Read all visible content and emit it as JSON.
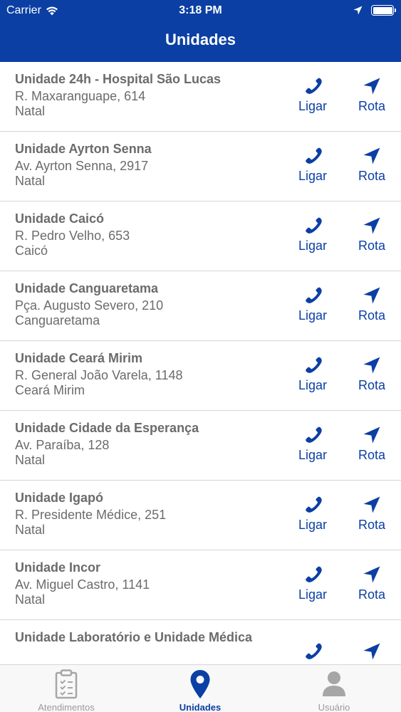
{
  "status_bar": {
    "carrier": "Carrier",
    "time": "3:18 PM"
  },
  "nav": {
    "title": "Unidades"
  },
  "actions": {
    "call_label": "Ligar",
    "route_label": "Rota"
  },
  "units": [
    {
      "name": "Unidade 24h - Hospital São Lucas",
      "address": "R. Maxaranguape, 614",
      "city": "Natal"
    },
    {
      "name": "Unidade Ayrton Senna",
      "address": "Av. Ayrton Senna, 2917",
      "city": "Natal"
    },
    {
      "name": "Unidade Caicó",
      "address": "R. Pedro Velho, 653",
      "city": "Caicó"
    },
    {
      "name": "Unidade Canguaretama",
      "address": "Pça. Augusto Severo, 210",
      "city": "Canguaretama"
    },
    {
      "name": "Unidade Ceará Mirim",
      "address": "R. General João Varela, 1148",
      "city": "Ceará Mirim"
    },
    {
      "name": "Unidade Cidade da Esperança",
      "address": "Av. Paraíba, 128",
      "city": "Natal"
    },
    {
      "name": "Unidade Igapó",
      "address": "R. Presidente Médice, 251",
      "city": "Natal"
    },
    {
      "name": "Unidade Incor",
      "address": "Av. Miguel Castro, 1141",
      "city": "Natal"
    },
    {
      "name": "Unidade Laboratório e Unidade Médica",
      "address": "",
      "city": ""
    }
  ],
  "tabs": [
    {
      "label": "Atendimentos",
      "icon": "clipboard-icon",
      "active": false
    },
    {
      "label": "Unidades",
      "icon": "location-pin-icon",
      "active": true
    },
    {
      "label": "Usuário",
      "icon": "user-icon",
      "active": false
    }
  ],
  "colors": {
    "primary": "#0b3fa4",
    "text": "#6b6b6b",
    "inactive_tab": "#9a9a9a",
    "divider": "#d6d6d6"
  }
}
